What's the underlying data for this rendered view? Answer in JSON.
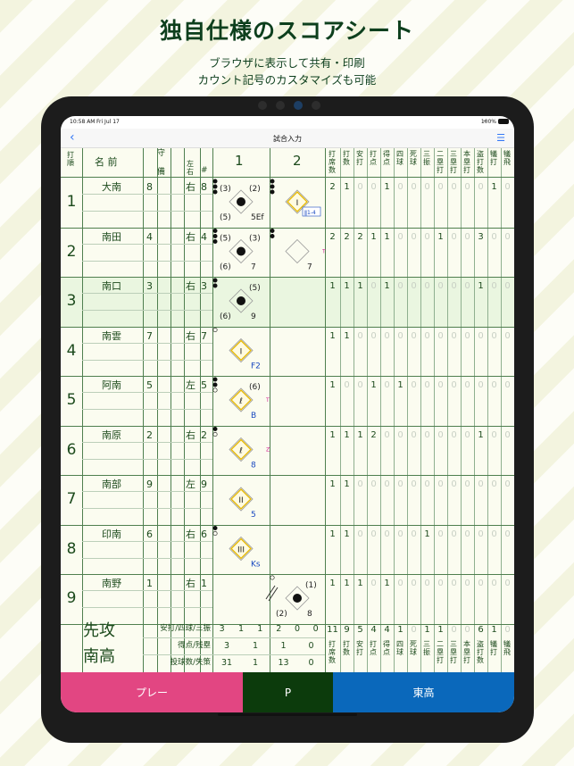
{
  "promo": {
    "title": "独自仕様のスコアシート",
    "line1": "ブラウザに表示して共有・印刷",
    "line2": "カウント記号のカスタマイズも可能"
  },
  "status": {
    "time": "10:58 AM",
    "date": "Fri Jul 17",
    "battery": "100%"
  },
  "nav": {
    "title": "試合入力",
    "back_icon": "chevron-left-icon",
    "menu_icon": "list-icon"
  },
  "header": {
    "order": [
      "打",
      "順"
    ],
    "name": "名 前",
    "position": "守",
    "position2": "備",
    "hand": [
      "左",
      "右"
    ],
    "num": "#",
    "inning1": "1",
    "inning2": "2",
    "stats": [
      [
        "打",
        "席",
        "数"
      ],
      [
        "打",
        "数"
      ],
      [
        "安",
        "打"
      ],
      [
        "打",
        "点"
      ],
      [
        "得",
        "点"
      ],
      [
        "四",
        "球"
      ],
      [
        "死",
        "球"
      ],
      [
        "三",
        "振"
      ],
      [
        "二",
        "塁",
        "打"
      ],
      [
        "三",
        "塁",
        "打"
      ],
      [
        "本",
        "塁",
        "打"
      ],
      [
        "盗",
        "打",
        "数"
      ],
      [
        "犠",
        "打"
      ],
      [
        "犠",
        "飛"
      ]
    ]
  },
  "batters": [
    {
      "order": "1",
      "name": "大南",
      "pos": "8",
      "hand": "右",
      "num": "8",
      "stats": [
        "2",
        "1",
        "0",
        "0",
        "1",
        "0",
        "0",
        "0",
        "0",
        "0",
        "0",
        "0",
        "1",
        "0"
      ]
    },
    {
      "order": "2",
      "name": "南田",
      "pos": "4",
      "hand": "右",
      "num": "4",
      "stats": [
        "2",
        "2",
        "2",
        "1",
        "1",
        "0",
        "0",
        "0",
        "1",
        "0",
        "0",
        "3",
        "0",
        "0"
      ]
    },
    {
      "order": "3",
      "name": "南口",
      "pos": "3",
      "hand": "右",
      "num": "3",
      "stats": [
        "1",
        "1",
        "1",
        "0",
        "1",
        "0",
        "0",
        "0",
        "0",
        "0",
        "0",
        "1",
        "0",
        "0"
      ]
    },
    {
      "order": "4",
      "name": "南雲",
      "pos": "7",
      "hand": "右",
      "num": "7",
      "stats": [
        "1",
        "1",
        "0",
        "0",
        "0",
        "0",
        "0",
        "0",
        "0",
        "0",
        "0",
        "0",
        "0",
        "0"
      ]
    },
    {
      "order": "5",
      "name": "阿南",
      "pos": "5",
      "hand": "左",
      "num": "5",
      "stats": [
        "1",
        "0",
        "0",
        "1",
        "0",
        "1",
        "0",
        "0",
        "0",
        "0",
        "0",
        "0",
        "0",
        "0"
      ]
    },
    {
      "order": "6",
      "name": "南原",
      "pos": "2",
      "hand": "右",
      "num": "2",
      "stats": [
        "1",
        "1",
        "1",
        "2",
        "0",
        "0",
        "0",
        "0",
        "0",
        "0",
        "0",
        "1",
        "0",
        "0"
      ]
    },
    {
      "order": "7",
      "name": "南部",
      "pos": "9",
      "hand": "左",
      "num": "9",
      "stats": [
        "1",
        "1",
        "0",
        "0",
        "0",
        "0",
        "0",
        "0",
        "0",
        "0",
        "0",
        "0",
        "0",
        "0"
      ]
    },
    {
      "order": "8",
      "name": "印南",
      "pos": "6",
      "hand": "右",
      "num": "6",
      "stats": [
        "1",
        "1",
        "0",
        "0",
        "0",
        "0",
        "0",
        "1",
        "0",
        "0",
        "0",
        "0",
        "0",
        "0"
      ]
    },
    {
      "order": "9",
      "name": "南野",
      "pos": "1",
      "hand": "右",
      "num": "1",
      "stats": [
        "1",
        "1",
        "1",
        "0",
        "1",
        "0",
        "0",
        "0",
        "0",
        "0",
        "0",
        "0",
        "0",
        "0"
      ]
    }
  ],
  "plays": {
    "r1i1": {
      "tl": "(3)",
      "tr": "(2)",
      "bl": "(5)",
      "br": "5Ef"
    },
    "r1i2": {
      "center": "I",
      "box": "ǁ1-4"
    },
    "r2i1": {
      "tl": "(5)",
      "tr": "(3)",
      "bl": "(6)",
      "br": "7"
    },
    "r2i2": {
      "br": "7",
      "side": "T"
    },
    "r3i1": {
      "tr": "(5)",
      "bl": "(6)",
      "br": "9"
    },
    "r4i1": {
      "center": "I",
      "br": "F2"
    },
    "r5i1": {
      "center": "ℓ",
      "tr": "(6)",
      "br": "B",
      "side": "T"
    },
    "r6i1": {
      "center": "ℓ",
      "br": "8",
      "side": "Z"
    },
    "r7i1": {
      "center": "II",
      "br": "5"
    },
    "r8i1": {
      "center": "III",
      "br": "Ks"
    },
    "r9i2": {
      "tr": "(1)",
      "bl": "(2)",
      "br": "8"
    }
  },
  "team": {
    "label": "先攻",
    "name": "南高"
  },
  "totals": {
    "rows": [
      {
        "label": "安打/四球/三振",
        "i1": [
          "3",
          "1",
          "1"
        ],
        "i2": [
          "2",
          "0",
          "0"
        ]
      },
      {
        "label": "得点/残塁",
        "i1": [
          "3",
          "1"
        ],
        "i2": [
          "1",
          "0"
        ]
      },
      {
        "label": "投球数/失策",
        "i1": [
          "31",
          "1"
        ],
        "i2": [
          "13",
          "0"
        ]
      }
    ],
    "stats": [
      "11",
      "9",
      "5",
      "4",
      "4",
      "1",
      "0",
      "1",
      "1",
      "0",
      "0",
      "6",
      "1",
      "0"
    ]
  },
  "buttons": {
    "play": "プレー",
    "p": "P",
    "team": "東高"
  },
  "colors": {
    "play": "#e24682",
    "p": "#0c3b0c",
    "team": "#0a68bb",
    "grid": "#4f7f4f"
  }
}
